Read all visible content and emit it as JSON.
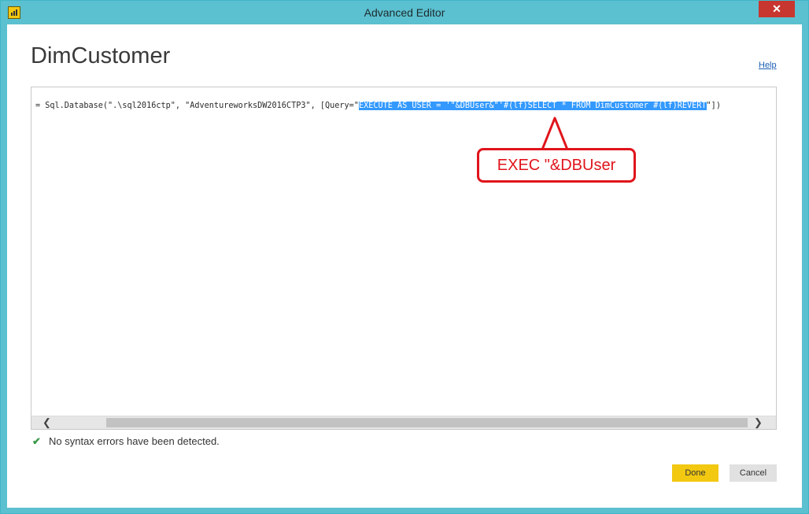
{
  "window": {
    "title": "Advanced Editor",
    "close_glyph": "✕"
  },
  "editor": {
    "heading": "DimCustomer",
    "help_label": "Help",
    "code_prefix": "= Sql.Database(\".\\sql2016ctp\", \"AdventureworksDW2016CTP3\", [Query=\"",
    "code_selected": "EXECUTE AS USER = '\"&DBUser&\"'#(lf)SELECT * FROM DimCustomer #(lf)REVERT",
    "code_suffix": "\"])",
    "scroll_left_glyph": "❮",
    "scroll_right_glyph": "❯"
  },
  "callout": {
    "text": "EXEC \"&DBUser",
    "color": "#e0141b"
  },
  "status": {
    "check_glyph": "✔",
    "message": "No syntax errors have been detected."
  },
  "buttons": {
    "done_label": "Done",
    "cancel_label": "Cancel"
  }
}
